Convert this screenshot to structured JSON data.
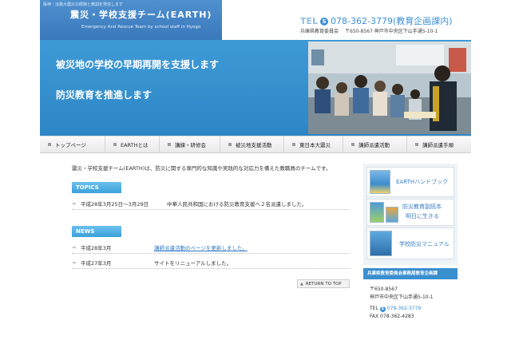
{
  "header": {
    "tagline": "阪神・淡路大震災の経験と教訓を発信します",
    "title": "震災・学校支援チーム(EARTH)",
    "subtitle": "Emergency And Rescue Team by school staff in Hyogo",
    "tel_label": "TEL",
    "tel": "078-362-3779(教育企画課内)",
    "org": "兵庫県教育委員会",
    "address": "〒650-8567 神戸市中央区下山手通5-10-1"
  },
  "hero": {
    "line1": "被災地の学校の早期再開を支援します",
    "line2": "防災教育を推進します"
  },
  "nav": {
    "items": [
      "トップページ",
      "EARTHとは",
      "講練・研修会",
      "被災地支援活動",
      "東日本大震災",
      "講師派遣活動",
      "講師派遣手順"
    ]
  },
  "intro": {
    "text": "震災・学校支援チーム(EARTH)は、防災に関する専門的な知識や実践的な対応力を備えた教職員のチームです。"
  },
  "topics": {
    "heading": "TOPICS",
    "items": [
      {
        "date": "平成28年3月25日～3月29日",
        "text": "中華人民共和国における防災教育支援へ２名派遣しました。"
      }
    ]
  },
  "news": {
    "heading": "NEWS",
    "items": [
      {
        "date": "平成28年3月",
        "text": "講師派遣活動のページを更新しました。",
        "is_link": true
      },
      {
        "date": "平成27年3月",
        "text": "サイトをリニューアルしました。",
        "is_link": false
      }
    ]
  },
  "return_top": "RETURN TO TOP",
  "sidebar": {
    "book1": "EARTHハンドブック",
    "book2_line1": "防災教育副読本",
    "book2_line2": "明日に生きる",
    "book3": "学校防災マニュアル",
    "contact_heading": "兵庫県教育委員会事務局教育企画課",
    "postal": "〒650-8567",
    "address": "神戸市中央区下山手通5-10-1",
    "tel_label": "TEL",
    "tel": "078-362-3779",
    "fax": "FAX 078-362-4283"
  },
  "colors": {
    "brand_blue": "#3a8fcf",
    "hero_blue": "#2d86c6",
    "link_blue": "#3278c4"
  }
}
